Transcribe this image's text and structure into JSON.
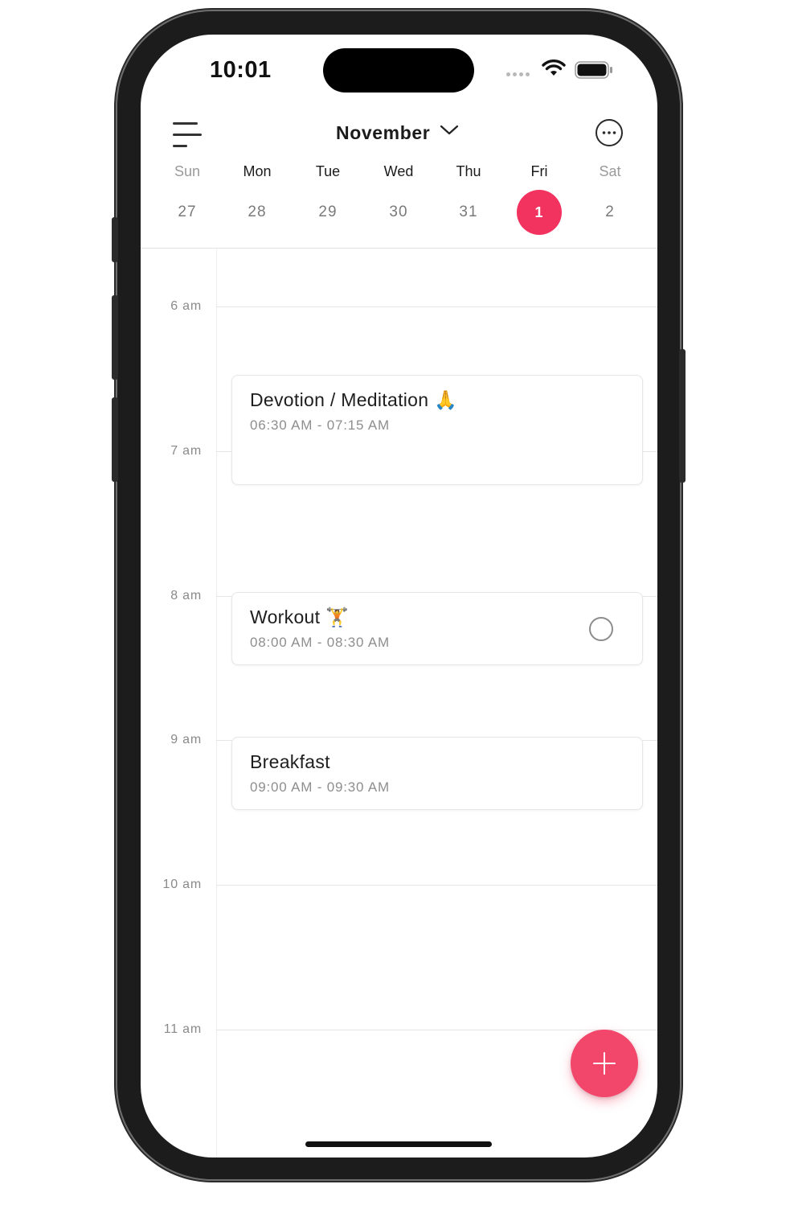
{
  "status_bar": {
    "time": "10:01"
  },
  "header": {
    "month": "November",
    "menu_icon": "menu-icon",
    "more_icon": "more-icon"
  },
  "week": {
    "days": [
      {
        "name": "Sun",
        "num": "27"
      },
      {
        "name": "Mon",
        "num": "28"
      },
      {
        "name": "Tue",
        "num": "29"
      },
      {
        "name": "Wed",
        "num": "30"
      },
      {
        "name": "Thu",
        "num": "31"
      },
      {
        "name": "Fri",
        "num": "1"
      },
      {
        "name": "Sat",
        "num": "2"
      }
    ],
    "selected_day": "Fri"
  },
  "timeline": {
    "hours": [
      "6 am",
      "7 am",
      "8 am",
      "9 am",
      "10 am",
      "11 am"
    ]
  },
  "events": [
    {
      "title": "Devotion / Meditation 🙏",
      "time": "06:30 AM - 07:15 AM"
    },
    {
      "title": "Workout 🏋️",
      "time": "08:00 AM - 08:30 AM"
    },
    {
      "title": "Breakfast",
      "time": "09:00 AM - 09:30 AM"
    }
  ],
  "fab": {
    "icon": "plus-icon"
  },
  "colors": {
    "accent": "#f2335f",
    "fab": "#f2476b"
  }
}
